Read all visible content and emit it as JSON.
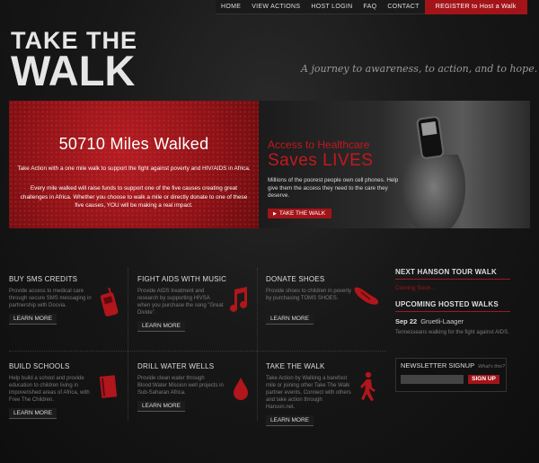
{
  "nav": {
    "items": [
      "HOME",
      "VIEW ACTIONS",
      "HOST LOGIN",
      "FAQ",
      "CONTACT"
    ],
    "register_label": "REGISTER to Host a Walk"
  },
  "logo": {
    "line1": "TAKE THE",
    "line2": "WALK"
  },
  "tagline": "A journey to awareness, to action, and to hope.",
  "hero": {
    "miles": "50710 Miles Walked",
    "line1": "Take Action with a one mile walk to support the fight against poverty and HIV/AIDS in Africa.",
    "line2": "Every mile walked will raise funds to support one of the five causes creating great challenges in Africa. Whether you choose to walk a mile or directly donate to one of these five causes, YOU will be making a real impact.",
    "right_title1": "Access to Healthcare",
    "right_title2": "Saves LIVES",
    "right_text": "Millions of the poorest people own cell phones. Help give them the access they need to the care they deserve.",
    "right_button": "TAKE THE WALK"
  },
  "causes": [
    {
      "title": "BUY SMS CREDITS",
      "text": "Provide access to medical care through secure SMS messaging in partnership with Docvia.",
      "button": "LEARN MORE",
      "icon": "cell-phone-icon"
    },
    {
      "title": "FIGHT AIDS WITH MUSIC",
      "text": "Provide AIDS treatment and research by supporting HIVSA when you purchase the song \"Great Divide\".",
      "button": "LEARN MORE",
      "icon": "music-note-icon"
    },
    {
      "title": "DONATE SHOES",
      "text": "Provide shoes to children in poverty by purchasing TOMS SHOES.",
      "button": "LEARN MORE",
      "icon": "shoe-icon"
    },
    {
      "title": "BUILD SCHOOLS",
      "text": "Help build a school and provide education to children living in impoverished areas of Africa, with Free The Children.",
      "button": "LEARN MORE",
      "icon": "book-icon"
    },
    {
      "title": "DRILL WATER WELLS",
      "text": "Provide clean water through Blood:Water Mission well projects in Sub-Saharan Africa.",
      "button": "LEARN MORE",
      "icon": "water-drop-icon"
    },
    {
      "title": "TAKE THE WALK",
      "text": "Take Action by Walking a barefoot mile or joining other Take The Walk partner events. Connect with others and take action through Hanson.net.",
      "button": "LEARN MORE",
      "icon": "walking-person-icon"
    }
  ],
  "sidebar": {
    "tour_heading": "NEXT HANSON TOUR WALK",
    "tour_status": "Coming Soon...",
    "upcoming_heading": "UPCOMING HOSTED WALKS",
    "event_date": "Sep 22",
    "event_name": "Gruetli-Laager",
    "event_desc": "Tennesseans walking for the fight against AIDS.",
    "newsletter_title": "NEWSLETTER SIGNUP",
    "newsletter_sub": "What's this?",
    "signup_label": "SIGN UP"
  },
  "colors": {
    "accent": "#a31419",
    "background": "#141414"
  }
}
